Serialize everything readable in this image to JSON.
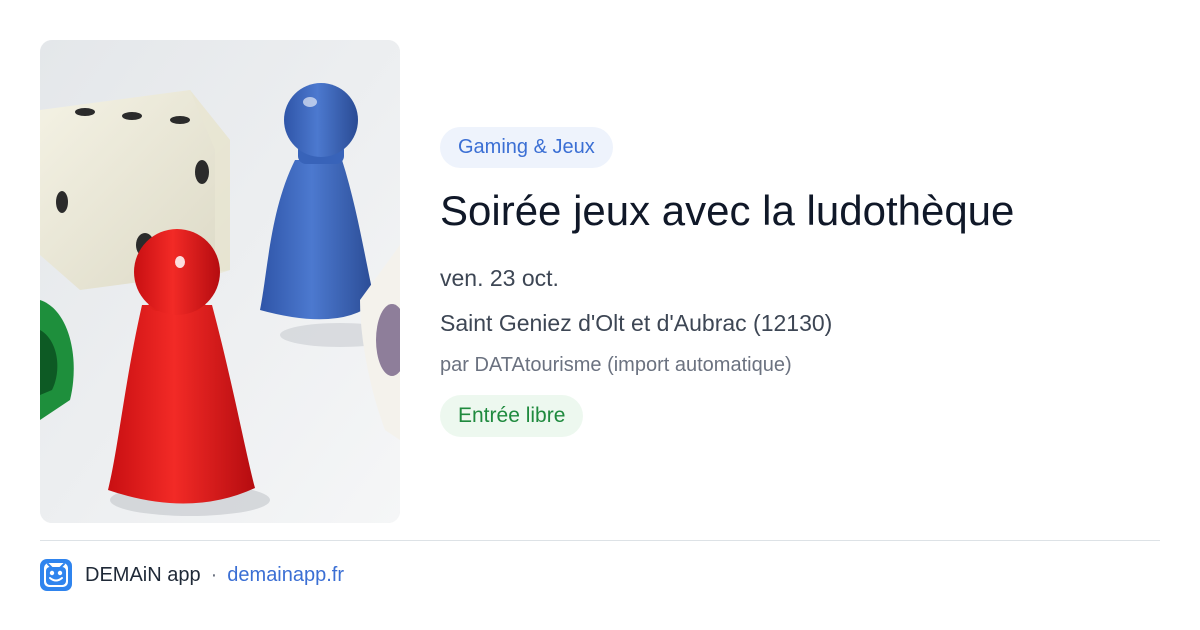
{
  "card": {
    "image_alt": "Game pawns and dice",
    "category": "Gaming & Jeux",
    "title": "Soirée jeux avec la ludothèque",
    "date": "ven. 23 oct.",
    "location": "Saint Geniez d'Olt et d'Aubrac (12130)",
    "organizer": "par DATAtourisme (import automatique)",
    "price": "Entrée libre"
  },
  "footer": {
    "app_name": "DEMAiN app",
    "separator": "·",
    "link": "demainapp.fr"
  },
  "colors": {
    "category_pill_bg": "#eef3fc",
    "category_text": "#3b6fd4",
    "price_pill_bg": "#edf8ef",
    "price_text": "#1f8a3e",
    "title_text": "#101828",
    "link": "#3b6fd4",
    "logo_blue": "#2f84ee"
  },
  "icons": {
    "app_logo": "demain-app-logo-icon"
  }
}
